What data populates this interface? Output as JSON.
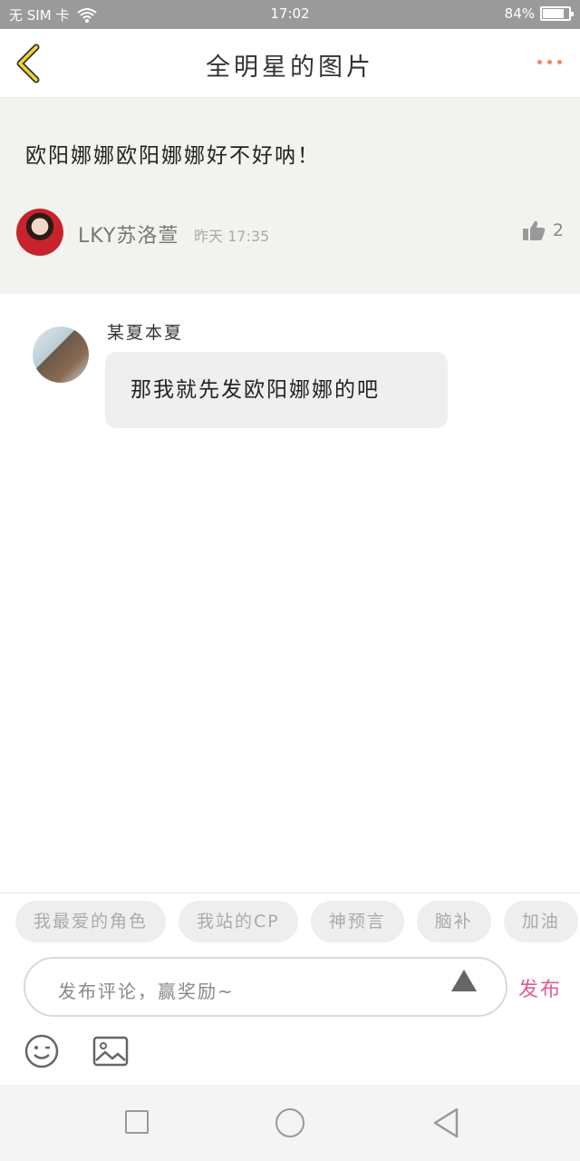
{
  "status_bar": {
    "carrier": "无 SIM 卡",
    "time": "17:02",
    "battery": "84%",
    "battery_level": 0.84,
    "icons": [
      "wifi-icon",
      "battery-icon"
    ]
  },
  "header": {
    "title": "全明星的图片",
    "back_icon": "chevron-left-icon",
    "more_icon": "more-dots-icon"
  },
  "post": {
    "text": "欧阳娜娜欧阳娜娜好不好呐！",
    "author": "LKY苏洛萱",
    "time": "昨天 17:35",
    "like_count": "2",
    "like_icon": "thumbs-up-icon"
  },
  "comments": [
    {
      "user": "某夏本夏",
      "text": "那我就先发欧阳娜娜的吧"
    }
  ],
  "composer": {
    "tags": [
      "我最爱的角色",
      "我站的CP",
      "神预言",
      "脑补",
      "加油"
    ],
    "placeholder": "发布评论，赢奖励~",
    "publish_label": "发布",
    "icons": [
      "send-arrow-icon",
      "emoji-icon",
      "image-icon"
    ]
  },
  "nav_bar": {
    "icons": [
      "recent-apps-icon",
      "home-icon",
      "back-icon"
    ]
  },
  "colors": {
    "accent_pink": "#e05a9a",
    "more_dots": "#f08a5d",
    "back_chevron": "#f2d23a",
    "post_bg": "#f2f2ee"
  }
}
